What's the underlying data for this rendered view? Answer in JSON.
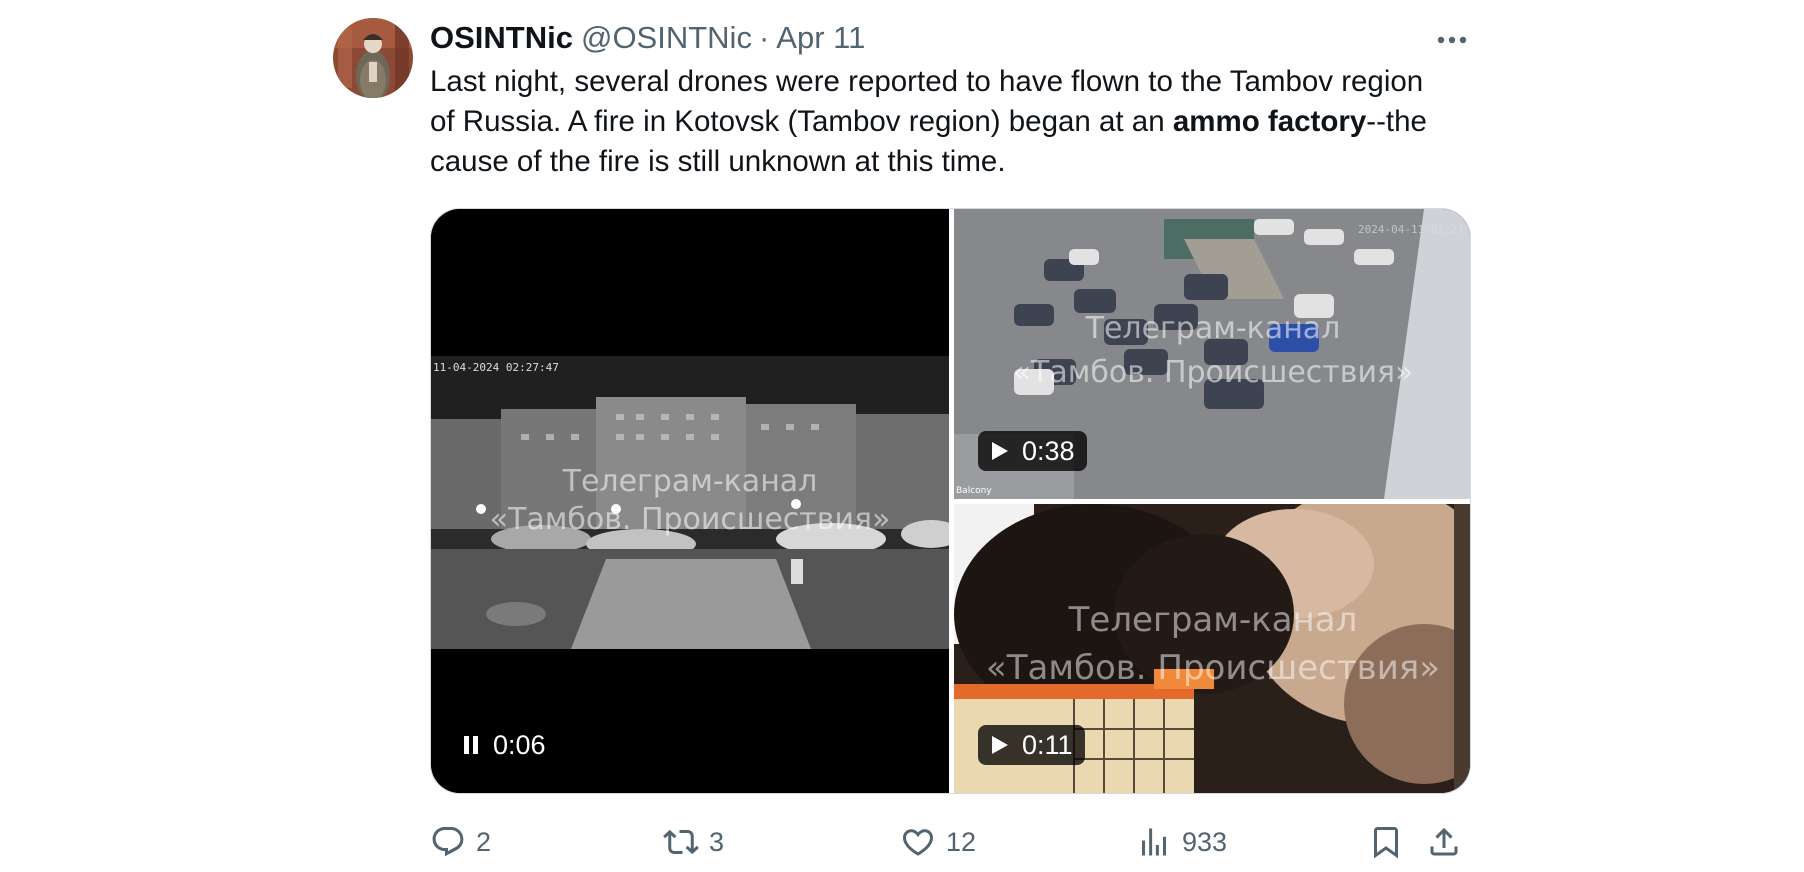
{
  "tweet": {
    "display_name": "OSINTNic",
    "handle": "@OSINTNic",
    "separator": "·",
    "date": "Apr 11",
    "text_part1": "Last night, several drones were reported to have flown to the Tambov region of Russia. A fire in Kotovsk (Tambov region) began at an ",
    "text_bold": "ammo factory",
    "text_part2": "--the cause of the fire is still unknown at this time."
  },
  "media": {
    "left_video": {
      "timestamp_overlay": "11-04-2024 02:27:47",
      "watermark_line1": "Телеграм-канал",
      "watermark_line2": "«Тамбов. Происшествия»",
      "duration": "0:06",
      "icon": "pause-icon"
    },
    "top_right_video": {
      "timestamp_overlay": "2024-04-11 02:27",
      "corner_label": "Balcony",
      "watermark_line1": "Телеграм-канал",
      "watermark_line2": "«Тамбов. Происшествия»",
      "duration": "0:38",
      "icon": "play-icon"
    },
    "bottom_right_video": {
      "watermark_line1": "Телеграм-канал",
      "watermark_line2": "«Тамбов. Происшествия»",
      "duration": "0:11",
      "icon": "play-icon"
    }
  },
  "actions": {
    "replies": "2",
    "reposts": "3",
    "likes": "12",
    "views": "933"
  },
  "colors": {
    "text_primary": "#0f1419",
    "text_secondary": "#536471",
    "border": "#cfd9de"
  }
}
